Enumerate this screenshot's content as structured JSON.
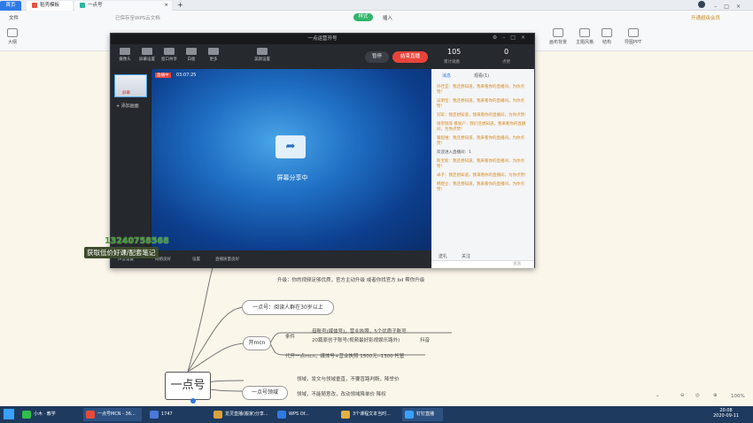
{
  "tabs": {
    "home": "首页",
    "t1": "稻壳模板",
    "t2": "一点号",
    "add": "+"
  },
  "toolbar": {
    "file": "文件",
    "saved": "已保存至WPS云文档",
    "style_tab": "样式",
    "insert_tab": "插入",
    "outline": "大纲",
    "member": "开通超级会员",
    "canvas_bg": "画布背景",
    "theme_style": "主题风格",
    "structure": "结构",
    "export": "导图PPT"
  },
  "window": {
    "title": "一点运营开号",
    "tools": [
      "摄像头",
      "屏幕设置",
      "窗口共享",
      "白板",
      "更多",
      "美颜设置"
    ],
    "pause": "暂停",
    "end": "结束直播",
    "live_tag": "直播中",
    "time": "03:07:25",
    "screen_label": "屏幕分享中",
    "add_scene": "+ 添加画面",
    "scene_name": "屏幕",
    "status": [
      "声音设置",
      "网络良好",
      "设置",
      "直播质量良好"
    ],
    "views": "105",
    "views_label": "累计观看",
    "likes": "0",
    "likes_label": "点赞",
    "panel_tabs": [
      "消息",
      "观看(1)"
    ],
    "messages": [
      "孙佳宜：我还想知道，我来看你的直播间，为你点赞!",
      "吴明宝：我还想知道，我来看你的直播间，为你点赞!",
      "刘军：我还想知道，我来看你的直播间，为你点赞!",
      "谢宗锐等·暴发户：我们还想知道，我来看你的直播间，为你点赞!",
      "蒙超维：我还想知道，我来看你的直播间，为你点赞!",
      "欢迎进入直播间：1",
      "陈宝新：我还想知道，我来看你的直播间，为你点赞!",
      "卓子：我还想知道，我来看你的直播间，为你点赞!",
      "韩煜立：我还想知道，我来看你的直播间，为你点赞!"
    ],
    "gifts": [
      "送礼",
      "关注"
    ],
    "send": "发送"
  },
  "overlay": {
    "phone": "13240758568",
    "promo": "获取低价好课/配套笔记"
  },
  "mindmap": {
    "root": "一点号",
    "upgrade": "升级：你的视频足够优质，官方主动升级 或者你找官方 bd 帮你升级",
    "node1": "一点号：阅读人群在30岁以上",
    "node2": "开mcn",
    "cond": "条件",
    "c1": "母账号(媒体号)，营业执照，5个优质子账号",
    "c2": "20篇原创子账号(视频最好影视娱乐路外)",
    "c2b": "抖音",
    "agent": "代开一点mcn，媒体号+营业执照  1500元--1300  托管",
    "node3": "一点号领域",
    "f1": "领域，发文与领域垂直，不要盲路判断，降举价",
    "f2": "领域，不能随意改，改动领域降单价 降权"
  },
  "zoom": "100%",
  "taskbar": {
    "items": [
      "小木 · 教学",
      "一点号MCN - 36...",
      "1747",
      "龙灵直播(搬家)分享...",
      "WPS Of...",
      "3个课程文本当时...",
      "钉钉直播"
    ],
    "time": "20:08",
    "date": "2020-09-11"
  },
  "colors": {
    "accent_blue": "#2f7ae5",
    "end_red": "#e8443a",
    "chat_orange": "#d88a1e",
    "taskbar": "#1e3a5f"
  }
}
